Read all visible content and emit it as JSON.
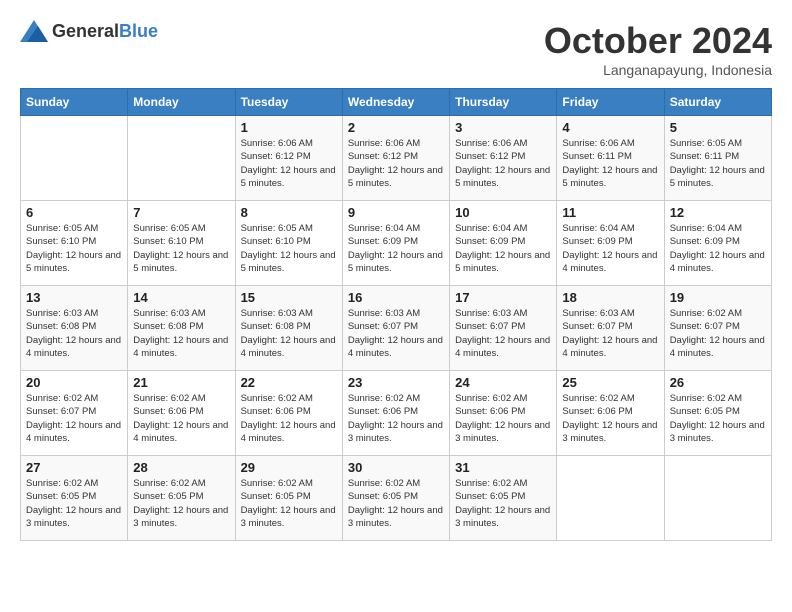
{
  "header": {
    "logo_general": "General",
    "logo_blue": "Blue",
    "month": "October 2024",
    "location": "Langanapayung, Indonesia"
  },
  "days_of_week": [
    "Sunday",
    "Monday",
    "Tuesday",
    "Wednesday",
    "Thursday",
    "Friday",
    "Saturday"
  ],
  "weeks": [
    [
      {
        "day": "",
        "info": ""
      },
      {
        "day": "",
        "info": ""
      },
      {
        "day": "1",
        "info": "Sunrise: 6:06 AM\nSunset: 6:12 PM\nDaylight: 12 hours and 5 minutes."
      },
      {
        "day": "2",
        "info": "Sunrise: 6:06 AM\nSunset: 6:12 PM\nDaylight: 12 hours and 5 minutes."
      },
      {
        "day": "3",
        "info": "Sunrise: 6:06 AM\nSunset: 6:12 PM\nDaylight: 12 hours and 5 minutes."
      },
      {
        "day": "4",
        "info": "Sunrise: 6:06 AM\nSunset: 6:11 PM\nDaylight: 12 hours and 5 minutes."
      },
      {
        "day": "5",
        "info": "Sunrise: 6:05 AM\nSunset: 6:11 PM\nDaylight: 12 hours and 5 minutes."
      }
    ],
    [
      {
        "day": "6",
        "info": "Sunrise: 6:05 AM\nSunset: 6:10 PM\nDaylight: 12 hours and 5 minutes."
      },
      {
        "day": "7",
        "info": "Sunrise: 6:05 AM\nSunset: 6:10 PM\nDaylight: 12 hours and 5 minutes."
      },
      {
        "day": "8",
        "info": "Sunrise: 6:05 AM\nSunset: 6:10 PM\nDaylight: 12 hours and 5 minutes."
      },
      {
        "day": "9",
        "info": "Sunrise: 6:04 AM\nSunset: 6:09 PM\nDaylight: 12 hours and 5 minutes."
      },
      {
        "day": "10",
        "info": "Sunrise: 6:04 AM\nSunset: 6:09 PM\nDaylight: 12 hours and 5 minutes."
      },
      {
        "day": "11",
        "info": "Sunrise: 6:04 AM\nSunset: 6:09 PM\nDaylight: 12 hours and 4 minutes."
      },
      {
        "day": "12",
        "info": "Sunrise: 6:04 AM\nSunset: 6:09 PM\nDaylight: 12 hours and 4 minutes."
      }
    ],
    [
      {
        "day": "13",
        "info": "Sunrise: 6:03 AM\nSunset: 6:08 PM\nDaylight: 12 hours and 4 minutes."
      },
      {
        "day": "14",
        "info": "Sunrise: 6:03 AM\nSunset: 6:08 PM\nDaylight: 12 hours and 4 minutes."
      },
      {
        "day": "15",
        "info": "Sunrise: 6:03 AM\nSunset: 6:08 PM\nDaylight: 12 hours and 4 minutes."
      },
      {
        "day": "16",
        "info": "Sunrise: 6:03 AM\nSunset: 6:07 PM\nDaylight: 12 hours and 4 minutes."
      },
      {
        "day": "17",
        "info": "Sunrise: 6:03 AM\nSunset: 6:07 PM\nDaylight: 12 hours and 4 minutes."
      },
      {
        "day": "18",
        "info": "Sunrise: 6:03 AM\nSunset: 6:07 PM\nDaylight: 12 hours and 4 minutes."
      },
      {
        "day": "19",
        "info": "Sunrise: 6:02 AM\nSunset: 6:07 PM\nDaylight: 12 hours and 4 minutes."
      }
    ],
    [
      {
        "day": "20",
        "info": "Sunrise: 6:02 AM\nSunset: 6:07 PM\nDaylight: 12 hours and 4 minutes."
      },
      {
        "day": "21",
        "info": "Sunrise: 6:02 AM\nSunset: 6:06 PM\nDaylight: 12 hours and 4 minutes."
      },
      {
        "day": "22",
        "info": "Sunrise: 6:02 AM\nSunset: 6:06 PM\nDaylight: 12 hours and 4 minutes."
      },
      {
        "day": "23",
        "info": "Sunrise: 6:02 AM\nSunset: 6:06 PM\nDaylight: 12 hours and 3 minutes."
      },
      {
        "day": "24",
        "info": "Sunrise: 6:02 AM\nSunset: 6:06 PM\nDaylight: 12 hours and 3 minutes."
      },
      {
        "day": "25",
        "info": "Sunrise: 6:02 AM\nSunset: 6:06 PM\nDaylight: 12 hours and 3 minutes."
      },
      {
        "day": "26",
        "info": "Sunrise: 6:02 AM\nSunset: 6:05 PM\nDaylight: 12 hours and 3 minutes."
      }
    ],
    [
      {
        "day": "27",
        "info": "Sunrise: 6:02 AM\nSunset: 6:05 PM\nDaylight: 12 hours and 3 minutes."
      },
      {
        "day": "28",
        "info": "Sunrise: 6:02 AM\nSunset: 6:05 PM\nDaylight: 12 hours and 3 minutes."
      },
      {
        "day": "29",
        "info": "Sunrise: 6:02 AM\nSunset: 6:05 PM\nDaylight: 12 hours and 3 minutes."
      },
      {
        "day": "30",
        "info": "Sunrise: 6:02 AM\nSunset: 6:05 PM\nDaylight: 12 hours and 3 minutes."
      },
      {
        "day": "31",
        "info": "Sunrise: 6:02 AM\nSunset: 6:05 PM\nDaylight: 12 hours and 3 minutes."
      },
      {
        "day": "",
        "info": ""
      },
      {
        "day": "",
        "info": ""
      }
    ]
  ]
}
